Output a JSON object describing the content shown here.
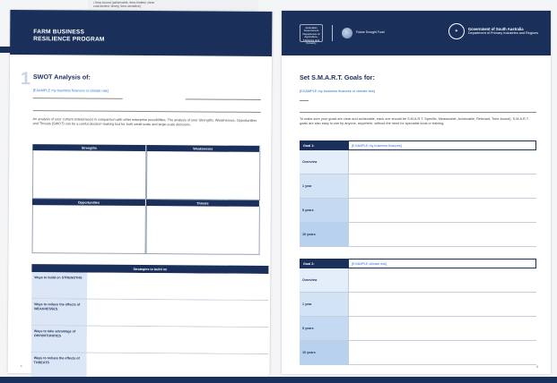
{
  "under_page": {
    "lines": [
      "• time-bound (achievable, time-limited, clear",
      "   cost-limited, timely, time-sensitive)"
    ]
  },
  "left_page": {
    "program_title_line1": "FARM BUSINESS",
    "program_title_line2": "RESILIENCE PROGRAM",
    "big_number": "1",
    "section_title": "SWOT Analysis of:",
    "example": "[EXAMPLE my business finances or climate risk]",
    "description": "An analysis of your current enterprise(s) in comparison with other enterprise possibilities. The analysis of your Strengths, Weaknesses, Opportunities and Threats (SWOT) can be a useful decision-making tool for both small-scale and large-scale decisions.",
    "swot_headers": [
      "Strengths",
      "Weaknesses",
      "Opportunities",
      "Threats"
    ],
    "strategies": {
      "title": "Strategies to build on",
      "rows": [
        "Ways to build on STRENGTHS",
        "Ways to reduce the effects of WEAKNESSES",
        "Ways to take advantage of OPPORTUNITIES",
        "Ways to reduce the effects of THREATS"
      ]
    },
    "page_number": "4"
  },
  "right_page": {
    "logos": {
      "crest_text": "Australian Government Department of Agriculture, Fisheries and Forestry",
      "fdf_text": "Future Drought Fund",
      "sa_line1": "Government of South Australia",
      "sa_line2": "Department of Primary Industries and Regions"
    },
    "section_title": "Set S.M.A.R.T. Goals for:",
    "example": "[EXAMPLE my business finances or climate risk]",
    "description": "To make sure your goals are clear and achievable, each one should be S.M.A.R.T. Specific, Measurable, Achievable, Relevant, Time-bound). S.M.A.R.T. goals are also easy to use by anyone, anywhere, without the need for specialist tools or training.",
    "goals": [
      {
        "label": "Goal 1:",
        "value": "[EXAMPLE my business finances]",
        "rows": [
          "Overview",
          "1 year",
          "5 years",
          "10 years"
        ]
      },
      {
        "label": "Goal 2:",
        "value": "[EXAMPLE climate risk]",
        "rows": [
          "Overview",
          "1 year",
          "5 years",
          "10 years"
        ]
      }
    ],
    "page_number": "5"
  },
  "colors": {
    "navy": "#1a2f5a",
    "link_blue": "#2c6fd6",
    "light_blue": "#dbe7f6"
  }
}
